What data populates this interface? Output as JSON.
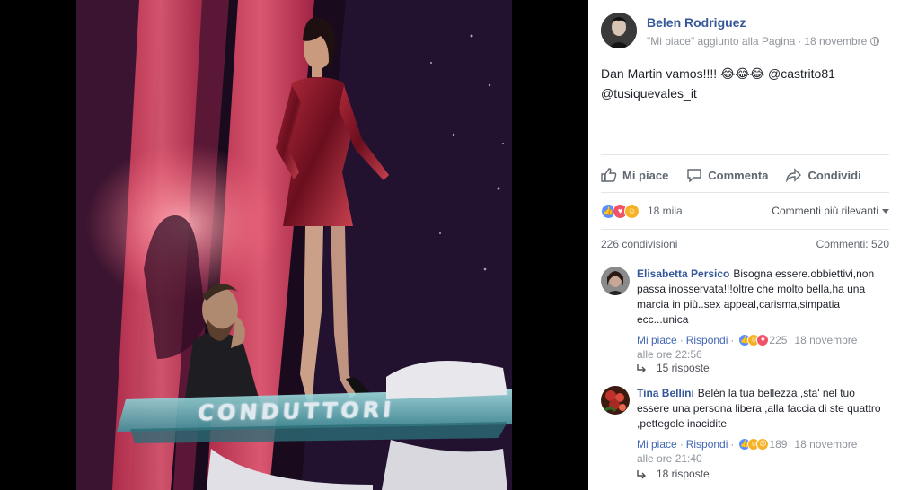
{
  "photo": {
    "caption_text": "CONDUTTORI"
  },
  "post": {
    "author": "Belen Rodriguez",
    "activity": "\"Mi piace\" aggiunto alla Pagina",
    "date": "18 novembre",
    "text_line1": "Dan Martin vamos!!!! 😂😂😂 @castrito81",
    "text_line2": "@tusiquevales_it",
    "privacy_icon": "globe-icon"
  },
  "actions": {
    "like": "Mi piace",
    "comment": "Commenta",
    "share": "Condividi"
  },
  "reactions": {
    "count": "18 mila",
    "types": [
      "like",
      "love",
      "haha"
    ],
    "sort_label": "Commenti più rilevanti"
  },
  "stats": {
    "shares": "226 condivisioni",
    "comments": "Commenti: 520"
  },
  "comments": [
    {
      "author": "Elisabetta Persico",
      "text": "Bisogna essere.obbiettivi,non passa inosservata!!!oltre che molto bella,ha una marcia in più..sex appeal,carisma,simpatia ecc...unica",
      "like_label": "Mi piace",
      "reply_label": "Rispondi",
      "reaction_count": "225",
      "date": "18 novembre",
      "time": "alle ore 22:56",
      "replies": "15 risposte"
    },
    {
      "author": "Tina Bellini",
      "text": "Belén la tua bellezza ,sta' nel tuo essere una persona libera ,alla faccia di ste quattro ,pettegole inacidite",
      "like_label": "Mi piace",
      "reply_label": "Rispondi",
      "reaction_count": "189",
      "date": "18 novembre",
      "time": "alle ore 21:40",
      "replies": "18 risposte"
    }
  ],
  "colors": {
    "link": "#365899",
    "meta": "#90949c",
    "like_blue": "#5890ff",
    "love_red": "#f25268",
    "haha_yellow": "#f7b125"
  }
}
